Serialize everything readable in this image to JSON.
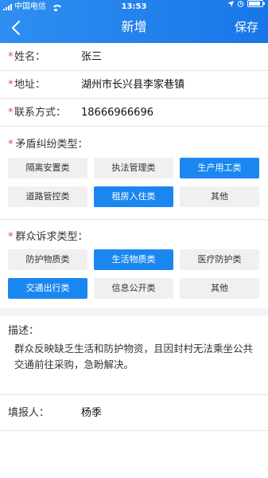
{
  "status_bar": {
    "carrier": "中国电信",
    "time": "13:53",
    "battery_percent": 90
  },
  "nav": {
    "title": "新增",
    "save_label": "保存",
    "back_icon": "chevron-left-icon"
  },
  "form": {
    "name": {
      "label": "姓名：",
      "value": "张三"
    },
    "address": {
      "label": "地址：",
      "value": "湖州市长兴县李家巷镇"
    },
    "contact": {
      "label": "联系方式：",
      "value": "18666966696"
    }
  },
  "dispute_types": {
    "title": "矛盾纠纷类型：",
    "options": [
      {
        "label": "隔离安置类",
        "selected": false
      },
      {
        "label": "执法管理类",
        "selected": false
      },
      {
        "label": "生产用工类",
        "selected": true
      },
      {
        "label": "道路管控类",
        "selected": false
      },
      {
        "label": "租房入住类",
        "selected": true
      },
      {
        "label": "其他",
        "selected": false
      }
    ]
  },
  "appeal_types": {
    "title": "群众诉求类型：",
    "options": [
      {
        "label": "防护物质类",
        "selected": false
      },
      {
        "label": "生活物质类",
        "selected": true
      },
      {
        "label": "医疗防护类",
        "selected": false
      },
      {
        "label": "交通出行类",
        "selected": true
      },
      {
        "label": "信息公开类",
        "selected": false
      },
      {
        "label": "其他",
        "selected": false
      }
    ]
  },
  "description": {
    "label": "描述：",
    "text": "群众反映缺乏生活和防护物资，且因封村无法乘坐公共交通前往采购，急盼解决。"
  },
  "reporter": {
    "label": "填报人：",
    "value": "杨季"
  },
  "colors": {
    "accent": "#1a87f0",
    "required": "#e24a4a",
    "chip_bg": "#f0f0f0"
  }
}
